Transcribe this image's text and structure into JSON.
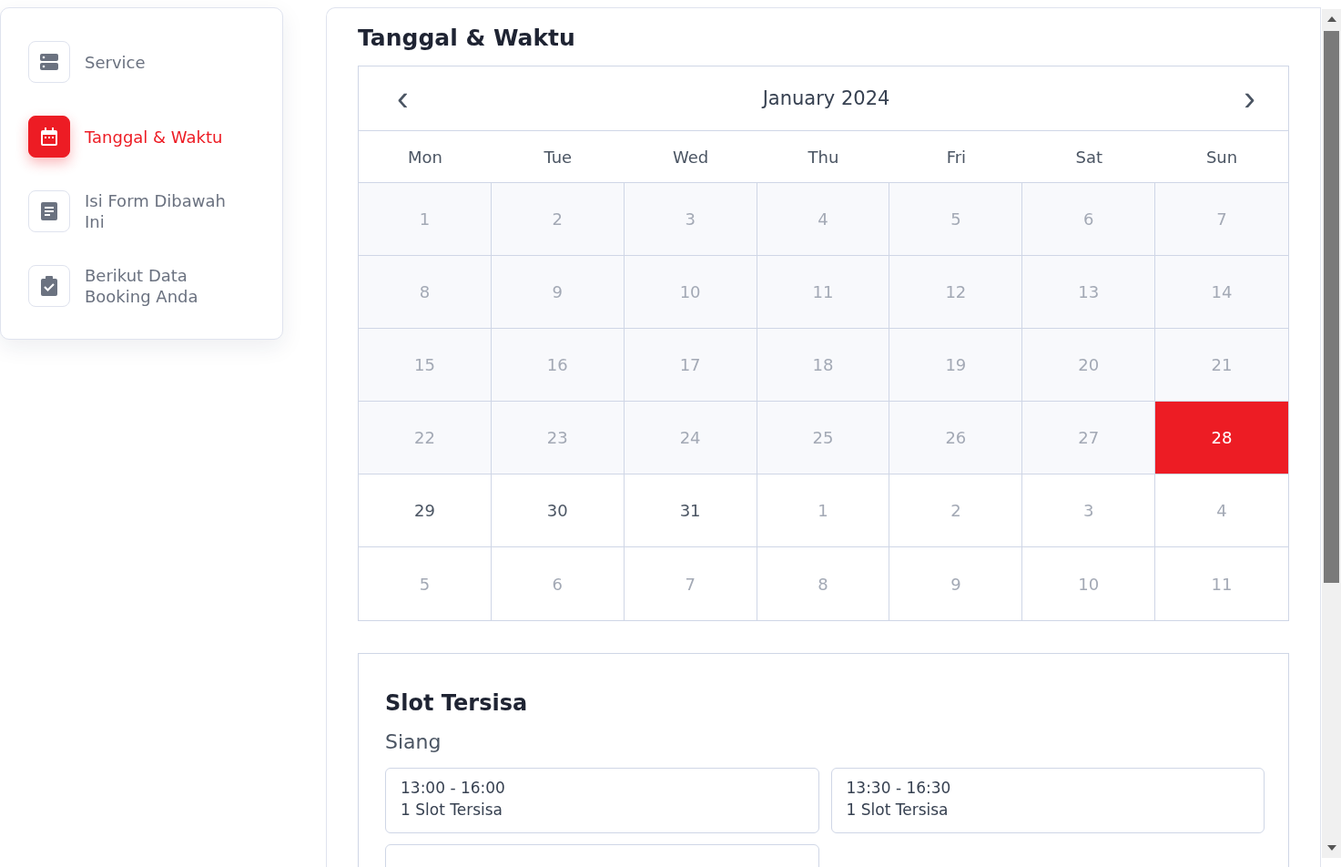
{
  "steps": [
    {
      "label": "Service",
      "selected": false
    },
    {
      "label": "Tanggal & Waktu",
      "selected": true
    },
    {
      "label": "Isi Form Dibawah Ini",
      "selected": false
    },
    {
      "label": "Berikut Data Booking Anda",
      "selected": false
    }
  ],
  "section_title": "Tanggal & Waktu",
  "calendar": {
    "month": "January 2024",
    "prev": "‹",
    "next": "›",
    "weekdays": [
      "Mon",
      "Tue",
      "Wed",
      "Thu",
      "Fri",
      "Sat",
      "Sun"
    ],
    "days": [
      {
        "text": "1",
        "kind": "past",
        "selected": false
      },
      {
        "text": "2",
        "kind": "past",
        "selected": false
      },
      {
        "text": "3",
        "kind": "past",
        "selected": false
      },
      {
        "text": "4",
        "kind": "past",
        "selected": false
      },
      {
        "text": "5",
        "kind": "past",
        "selected": false
      },
      {
        "text": "6",
        "kind": "past",
        "selected": false
      },
      {
        "text": "7",
        "kind": "past",
        "selected": false
      },
      {
        "text": "8",
        "kind": "past",
        "selected": false
      },
      {
        "text": "9",
        "kind": "past",
        "selected": false
      },
      {
        "text": "10",
        "kind": "past",
        "selected": false
      },
      {
        "text": "11",
        "kind": "past",
        "selected": false
      },
      {
        "text": "12",
        "kind": "past",
        "selected": false
      },
      {
        "text": "13",
        "kind": "past",
        "selected": false
      },
      {
        "text": "14",
        "kind": "past",
        "selected": false
      },
      {
        "text": "15",
        "kind": "past",
        "selected": false
      },
      {
        "text": "16",
        "kind": "past",
        "selected": false
      },
      {
        "text": "17",
        "kind": "past",
        "selected": false
      },
      {
        "text": "18",
        "kind": "past",
        "selected": false
      },
      {
        "text": "19",
        "kind": "past",
        "selected": false
      },
      {
        "text": "20",
        "kind": "past",
        "selected": false
      },
      {
        "text": "21",
        "kind": "past",
        "selected": false
      },
      {
        "text": "22",
        "kind": "past",
        "selected": false
      },
      {
        "text": "23",
        "kind": "past",
        "selected": false
      },
      {
        "text": "24",
        "kind": "past",
        "selected": false
      },
      {
        "text": "25",
        "kind": "past",
        "selected": false
      },
      {
        "text": "26",
        "kind": "past",
        "selected": false
      },
      {
        "text": "27",
        "kind": "past",
        "selected": false
      },
      {
        "text": "28",
        "kind": "available",
        "selected": true
      },
      {
        "text": "29",
        "kind": "available",
        "selected": false
      },
      {
        "text": "30",
        "kind": "available",
        "selected": false
      },
      {
        "text": "31",
        "kind": "available",
        "selected": false
      },
      {
        "text": "1",
        "kind": "outside",
        "selected": false
      },
      {
        "text": "2",
        "kind": "outside",
        "selected": false
      },
      {
        "text": "3",
        "kind": "outside",
        "selected": false
      },
      {
        "text": "4",
        "kind": "outside",
        "selected": false
      },
      {
        "text": "5",
        "kind": "outside",
        "selected": false
      },
      {
        "text": "6",
        "kind": "outside",
        "selected": false
      },
      {
        "text": "7",
        "kind": "outside",
        "selected": false
      },
      {
        "text": "8",
        "kind": "outside",
        "selected": false
      },
      {
        "text": "9",
        "kind": "outside",
        "selected": false
      },
      {
        "text": "10",
        "kind": "outside",
        "selected": false
      },
      {
        "text": "11",
        "kind": "outside",
        "selected": false
      }
    ]
  },
  "slots": {
    "title": "Slot Tersisa",
    "period": "Siang",
    "options": [
      {
        "time": "13:00 - 16:00",
        "remaining": "1 Slot Tersisa"
      },
      {
        "time": "13:30 - 16:30",
        "remaining": "1 Slot Tersisa"
      }
    ]
  }
}
